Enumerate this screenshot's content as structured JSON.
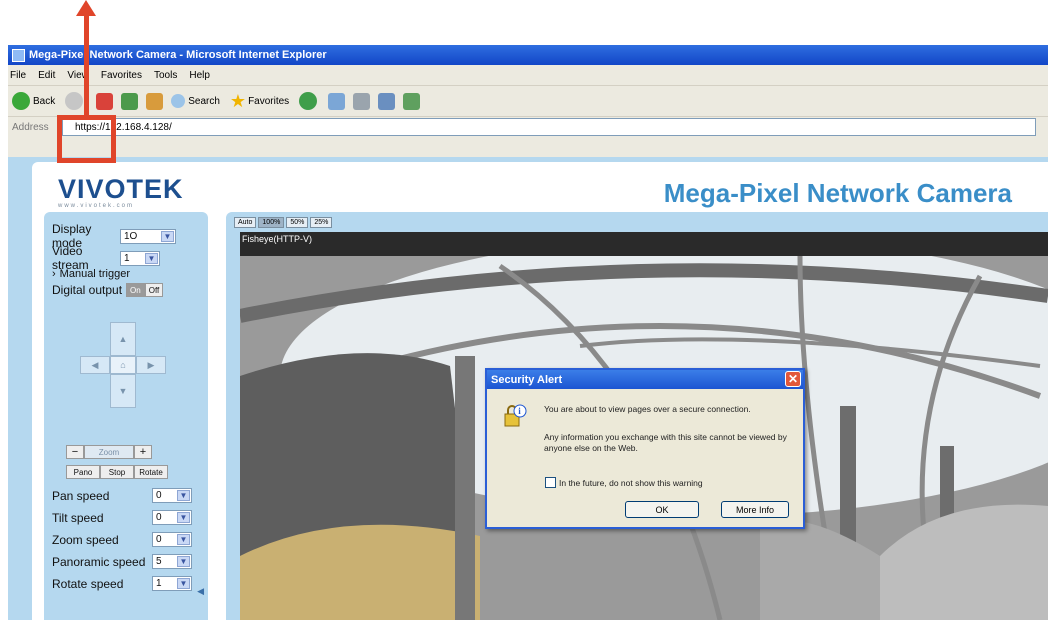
{
  "window": {
    "title": "Mega-Pixel Network Camera - Microsoft Internet Explorer"
  },
  "menu": [
    "File",
    "Edit",
    "View",
    "Favorites",
    "Tools",
    "Help"
  ],
  "toolbar": {
    "back": "Back",
    "search": "Search",
    "favorites": "Favorites"
  },
  "address": {
    "label": "Address",
    "url": "https://192.168.4.128/"
  },
  "page": {
    "logo": "VIVOTEK",
    "logo_tag": "www.vivotek.com",
    "title": "Mega-Pixel Network Camera"
  },
  "controls": {
    "display_mode_label": "Display mode",
    "display_mode_value": "1O",
    "video_stream_label": "Video stream",
    "video_stream_value": "1",
    "manual_trigger": "Manual trigger",
    "digital_output_label": "Digital output",
    "digital_on": "On",
    "digital_off": "Off",
    "zoom_minus": "−",
    "zoom_label": "Zoom",
    "zoom_plus": "+",
    "pano": "Pano",
    "stop": "Stop",
    "rotate": "Rotate",
    "speeds": [
      {
        "label": "Pan speed",
        "value": "0"
      },
      {
        "label": "Tilt speed",
        "value": "0"
      },
      {
        "label": "Zoom speed",
        "value": "0"
      },
      {
        "label": "Panoramic speed",
        "value": "5"
      },
      {
        "label": "Rotate speed",
        "value": "1"
      }
    ]
  },
  "video": {
    "size_buttons": [
      "Auto",
      "100%",
      "50%",
      "25%"
    ],
    "label": "Fisheye(HTTP-V)"
  },
  "dialog": {
    "title": "Security Alert",
    "message1": "You are about to view pages over a secure connection.",
    "message2": "Any information you exchange with this site cannot be viewed by anyone else on the Web.",
    "checkbox": "In the future, do not show this warning",
    "ok": "OK",
    "more_info": "More Info"
  },
  "colors": {
    "annotation": "#e0452a",
    "brand_blue": "#3a8ec8",
    "panel": "#b5d8ef"
  }
}
